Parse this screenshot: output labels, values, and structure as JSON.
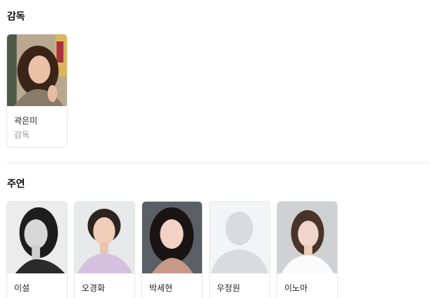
{
  "director_section": {
    "title": "감독",
    "people": [
      {
        "name": "곽은미",
        "role": "감독",
        "photo": "director-portrait"
      }
    ]
  },
  "cast_section": {
    "title": "주연",
    "people": [
      {
        "name": "이설",
        "photo": "actor-portrait"
      },
      {
        "name": "오경화",
        "photo": "actor-portrait"
      },
      {
        "name": "박세현",
        "photo": "actor-portrait"
      },
      {
        "name": "우정원",
        "photo": "placeholder-avatar"
      },
      {
        "name": "이노아",
        "photo": "actor-portrait"
      }
    ]
  }
}
